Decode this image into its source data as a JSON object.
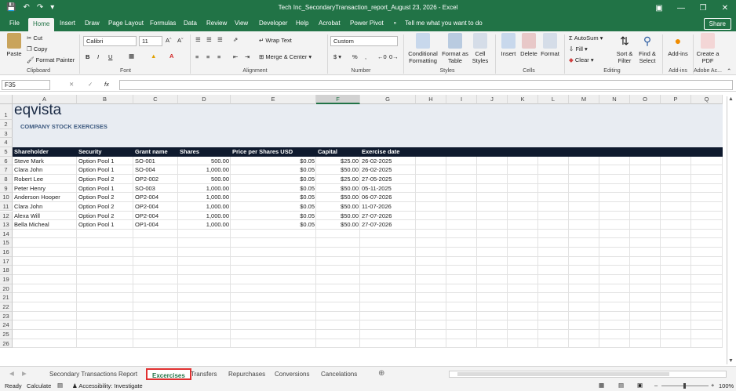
{
  "window": {
    "title": "Tech Inc_SecondaryTransaction_report_August 23, 2026  -  Excel"
  },
  "menu": {
    "tabs": [
      "File",
      "Home",
      "Insert",
      "Draw",
      "Page Layout",
      "Formulas",
      "Data",
      "Review",
      "View",
      "Developer",
      "Help",
      "Acrobat",
      "Power Pivot"
    ],
    "tell_me": "Tell me what you want to do",
    "share": "Share"
  },
  "ribbon": {
    "clipboard": {
      "label": "Clipboard",
      "paste": "Paste",
      "cut": "Cut",
      "copy": "Copy",
      "format_painter": "Format Painter"
    },
    "font": {
      "label": "Font",
      "family": "Calibri",
      "size": "11"
    },
    "alignment": {
      "label": "Alignment",
      "wrap": "Wrap Text",
      "merge": "Merge & Center"
    },
    "number": {
      "label": "Number",
      "format": "Custom"
    },
    "styles": {
      "label": "Styles",
      "conditional": "Conditional Formatting",
      "format_table": "Format as Table",
      "cell_styles": "Cell Styles"
    },
    "cells": {
      "label": "Cells",
      "insert": "Insert",
      "delete": "Delete",
      "format": "Format"
    },
    "editing": {
      "label": "Editing",
      "autosum": "AutoSum",
      "fill": "Fill",
      "clear": "Clear",
      "sort": "Sort & Filter",
      "find": "Find & Select"
    },
    "addins": {
      "label": "Add-ins",
      "addins": "Add-ins"
    },
    "adobe": {
      "label": "Adobe Ac...",
      "create_pdf": "Create a PDF"
    }
  },
  "formula_bar": {
    "name_box": "F35",
    "fx": "fx",
    "value": ""
  },
  "columns": [
    "A",
    "B",
    "C",
    "D",
    "E",
    "F",
    "G",
    "H",
    "I",
    "J",
    "K",
    "L",
    "M",
    "N",
    "O",
    "P",
    "Q"
  ],
  "rows": [
    "1",
    "2",
    "3",
    "4",
    "5",
    "6",
    "7",
    "8",
    "9",
    "10",
    "11",
    "12",
    "13",
    "14",
    "15",
    "16",
    "17",
    "18",
    "19",
    "20",
    "21",
    "22",
    "23",
    "24",
    "25",
    "26"
  ],
  "sheet": {
    "logo": "eqvista",
    "heading": "COMPANY STOCK EXERCISES",
    "headers": [
      "Shareholder",
      "Security",
      "Grant name",
      "Shares",
      "Price per Shares USD",
      "Capital",
      "Exercise date"
    ],
    "data": [
      [
        "Steve Mark",
        "Option Pool 1",
        "SO-001",
        "500.00",
        "$0.05",
        "$25.00",
        "26-02-2025"
      ],
      [
        "Clara John",
        "Option Pool 1",
        "SO-004",
        "1,000.00",
        "$0.05",
        "$50.00",
        "26-02-2025"
      ],
      [
        "Robert Lee",
        "Option Pool 2",
        "OP2-002",
        "500.00",
        "$0.05",
        "$25.00",
        "27-05-2025"
      ],
      [
        "Peter Henry",
        "Option Pool 1",
        "SO-003",
        "1,000.00",
        "$0.05",
        "$50.00",
        "05-11-2025"
      ],
      [
        "Anderson Hooper",
        "Option Pool 2",
        "OP2-004",
        "1,000.00",
        "$0.05",
        "$50.00",
        "06-07-2026"
      ],
      [
        "Clara John",
        "Option Pool 2",
        "OP2-004",
        "1,000.00",
        "$0.05",
        "$50.00",
        "11-07-2026"
      ],
      [
        "Alexa Will",
        "Option Pool 2",
        "OP2-004",
        "1,000.00",
        "$0.05",
        "$50.00",
        "27-07-2026"
      ],
      [
        "Bella Micheal",
        "Option Pool 1",
        "OP1-004",
        "1,000.00",
        "$0.05",
        "$50.00",
        "27-07-2026"
      ]
    ]
  },
  "sheet_tabs": [
    "Secondary Transactions Report",
    "Excercises",
    "Transfers",
    "Repurchases",
    "Conversions",
    "Cancelations"
  ],
  "active_sheet": "Excercises",
  "status": {
    "ready": "Ready",
    "calculate": "Calculate",
    "accessibility": "Accessibility: Investigate",
    "zoom": "100%"
  },
  "colors": {
    "accent": "#217346",
    "header_bg": "#0f1a2e",
    "title_band": "#e8ecf2",
    "heading_text": "#3d5a80"
  }
}
